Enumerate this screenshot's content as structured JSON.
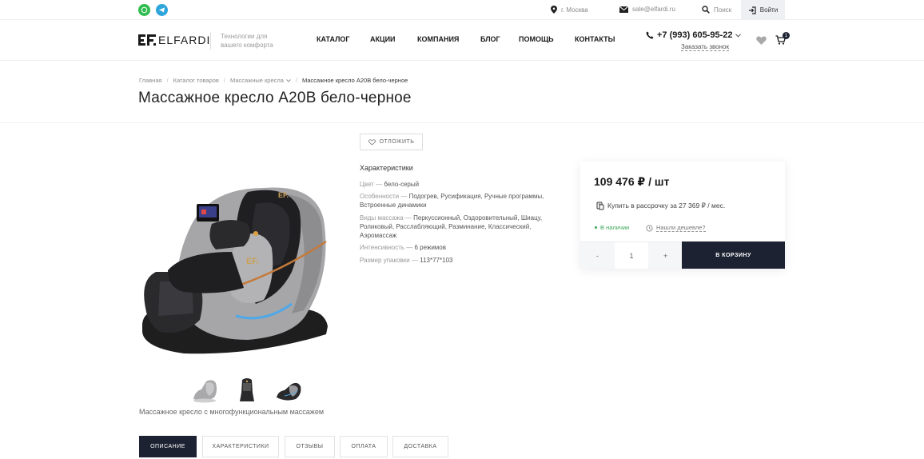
{
  "topbar": {
    "city": "г. Москва",
    "email": "sale@elfardi.ru",
    "search": "Поиск",
    "login": "Войти"
  },
  "header": {
    "logo": "ELFARDI",
    "tagline": "Технологии для вашего комфорта",
    "nav": [
      "КАТАЛОГ",
      "АКЦИИ",
      "КОМПАНИЯ",
      "БЛОГ",
      "ПОМОЩЬ",
      "КОНТАКТЫ"
    ],
    "phone": "+7 (993) 605-95-22",
    "callback": "Заказать звонок",
    "cart_count": "1"
  },
  "breadcrumb": [
    "Главная",
    "Каталог товаров",
    "Массажные кресла",
    "Массажное кресло A20B бело-черное"
  ],
  "product": {
    "title": "Массажное кресло A20B бело-черное",
    "postpone": "ОТЛОЖИТЬ",
    "caption": "Массажное кресло с многофункциональным массажем",
    "specs_title": "Характеристики",
    "specs": [
      {
        "label": "Цвет",
        "value": "бело-серый"
      },
      {
        "label": "Особенности",
        "value": "Подогрев, Русификация, Ручные программы, Встроенные динамики"
      },
      {
        "label": "Виды массажа",
        "value": "Перкуссионный, Оздоровительный, Шиацу, Роликовый, Расслабляющий, Разминание, Классический, Аэромассаж"
      },
      {
        "label": "Интенсивность",
        "value": "6 режимов"
      },
      {
        "label": "Размер упаковки",
        "value": "113*77*103"
      }
    ]
  },
  "buy": {
    "price": "109 476 ₽ / шт",
    "installment": "Купить в рассрочку за 27 369 ₽ / мес.",
    "stock": "В наличии",
    "cheaper": "Нашли дешевле?",
    "minus": "-",
    "quantity": "1",
    "plus": "+",
    "to_cart": "В КОРЗИНУ"
  },
  "tabs": [
    "ОПИСАНИЕ",
    "ХАРАКТЕРИСТИКИ",
    "ОТЗЫВЫ",
    "ОПЛАТА",
    "ДОСТАВКА"
  ],
  "colors": {
    "accent": "#1d2232",
    "in_stock": "#3aa857",
    "whatsapp": "#2fbd4f",
    "telegram": "#2ea6dc"
  }
}
